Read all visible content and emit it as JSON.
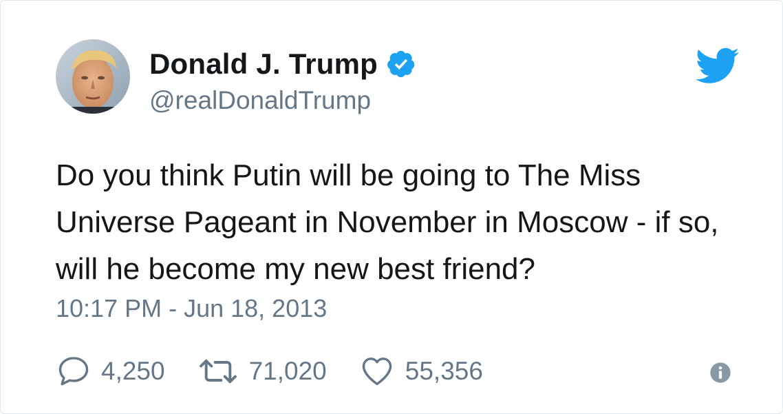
{
  "user": {
    "display_name": "Donald J. Trump",
    "handle": "@realDonaldTrump",
    "verified": true,
    "avatar_icon": "profile-photo"
  },
  "brand_icon": "twitter-bird-icon",
  "tweet": {
    "text": "Do you think Putin will be going to The Miss Universe Pageant in November in Moscow - if so, will he become my new best friend?",
    "timestamp": "10:17 PM - Jun 18, 2013"
  },
  "actions": {
    "replies": "4,250",
    "retweets": "71,020",
    "likes": "55,356"
  },
  "colors": {
    "twitter_blue": "#1da1f2",
    "text": "#14171a",
    "secondary": "#657786"
  }
}
